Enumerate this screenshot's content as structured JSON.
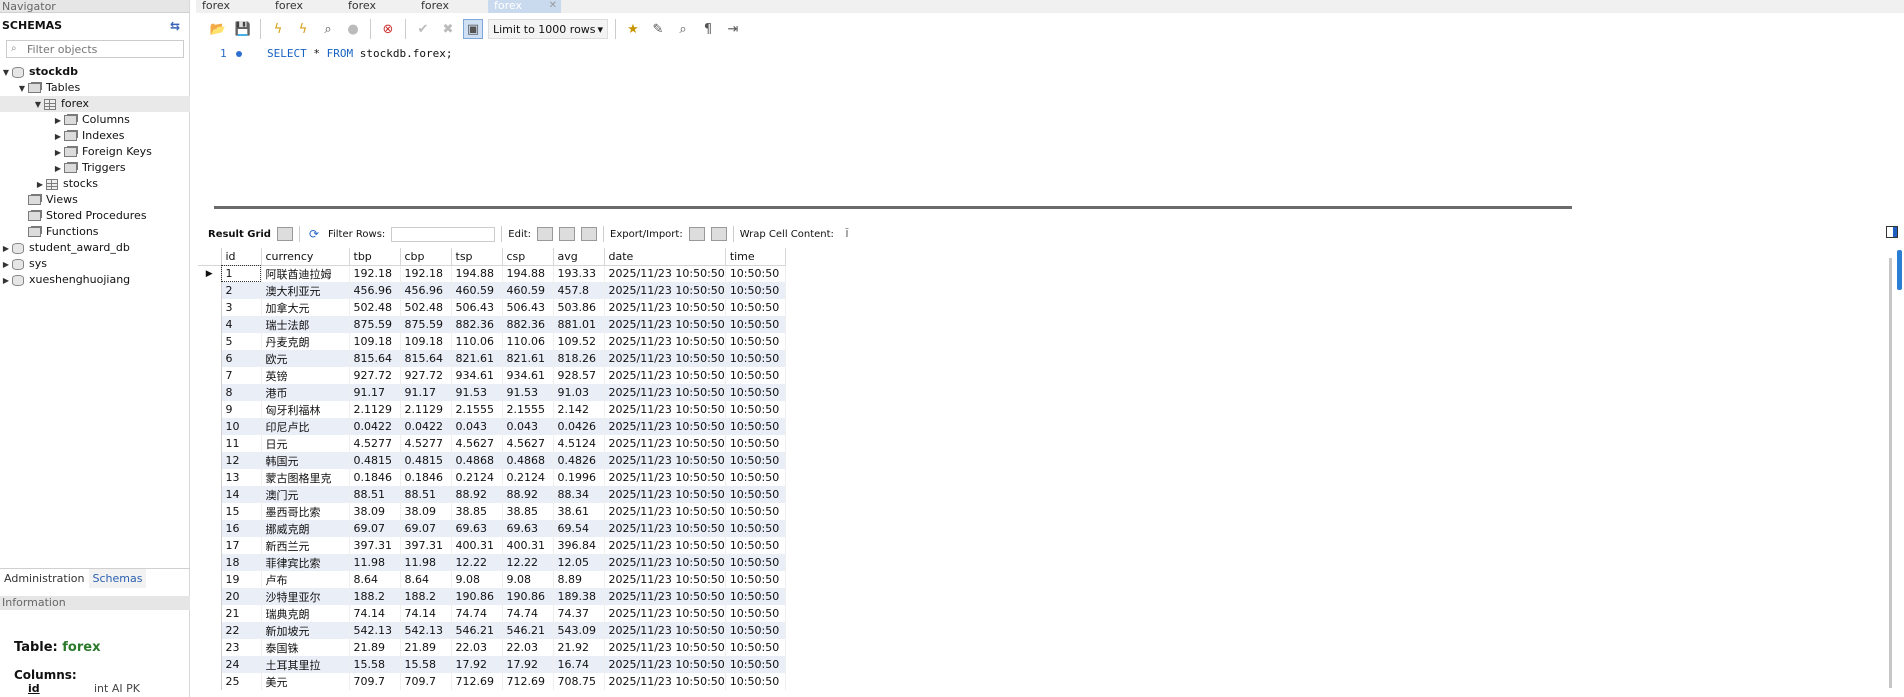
{
  "navigator": {
    "title": "Navigator",
    "schemas_label": "SCHEMAS",
    "filter_placeholder": "Filter objects",
    "tree": [
      {
        "label": "stockdb",
        "bold": true
      },
      {
        "label": "Tables"
      },
      {
        "label": "forex"
      },
      {
        "label": "Columns"
      },
      {
        "label": "Indexes"
      },
      {
        "label": "Foreign Keys"
      },
      {
        "label": "Triggers"
      },
      {
        "label": "stocks"
      },
      {
        "label": "Views"
      },
      {
        "label": "Stored Procedures"
      },
      {
        "label": "Functions"
      },
      {
        "label": "student_award_db"
      },
      {
        "label": "sys"
      },
      {
        "label": "xueshenghuojiang"
      }
    ],
    "bottom_tabs": [
      "Administration",
      "Schemas"
    ],
    "info_title": "Information",
    "info_table_label": "Table:",
    "info_table_name": "forex",
    "info_columns_label": "Columns:",
    "info_col_name": "id",
    "info_col_type": "int AI PK"
  },
  "editor": {
    "tabs": [
      "forex",
      "forex",
      "forex",
      "forex",
      "forex"
    ],
    "limit_label": "Limit to 1000 rows",
    "line_number": "1",
    "sql_kw1": "SELECT",
    "sql_mid": " * ",
    "sql_kw2": "FROM",
    "sql_rest": " stockdb.forex;"
  },
  "result_bar": {
    "result_grid": "Result Grid",
    "filter_rows": "Filter Rows:",
    "edit": "Edit:",
    "export_import": "Export/Import:",
    "wrap": "Wrap Cell Content:"
  },
  "grid": {
    "columns": [
      "id",
      "currency",
      "tbp",
      "cbp",
      "tsp",
      "csp",
      "avg",
      "date",
      "time"
    ],
    "rows": [
      [
        "1",
        "阿联酋迪拉姆",
        "192.18",
        "192.18",
        "194.88",
        "194.88",
        "193.33",
        "2025/11/23 10:50:50",
        "10:50:50"
      ],
      [
        "2",
        "澳大利亚元",
        "456.96",
        "456.96",
        "460.59",
        "460.59",
        "457.8",
        "2025/11/23 10:50:50",
        "10:50:50"
      ],
      [
        "3",
        "加拿大元",
        "502.48",
        "502.48",
        "506.43",
        "506.43",
        "503.86",
        "2025/11/23 10:50:50",
        "10:50:50"
      ],
      [
        "4",
        "瑞士法郎",
        "875.59",
        "875.59",
        "882.36",
        "882.36",
        "881.01",
        "2025/11/23 10:50:50",
        "10:50:50"
      ],
      [
        "5",
        "丹麦克朗",
        "109.18",
        "109.18",
        "110.06",
        "110.06",
        "109.52",
        "2025/11/23 10:50:50",
        "10:50:50"
      ],
      [
        "6",
        "欧元",
        "815.64",
        "815.64",
        "821.61",
        "821.61",
        "818.26",
        "2025/11/23 10:50:50",
        "10:50:50"
      ],
      [
        "7",
        "英镑",
        "927.72",
        "927.72",
        "934.61",
        "934.61",
        "928.57",
        "2025/11/23 10:50:50",
        "10:50:50"
      ],
      [
        "8",
        "港币",
        "91.17",
        "91.17",
        "91.53",
        "91.53",
        "91.03",
        "2025/11/23 10:50:50",
        "10:50:50"
      ],
      [
        "9",
        "匈牙利福林",
        "2.1129",
        "2.1129",
        "2.1555",
        "2.1555",
        "2.142",
        "2025/11/23 10:50:50",
        "10:50:50"
      ],
      [
        "10",
        "印尼卢比",
        "0.0422",
        "0.0422",
        "0.043",
        "0.043",
        "0.0426",
        "2025/11/23 10:50:50",
        "10:50:50"
      ],
      [
        "11",
        "日元",
        "4.5277",
        "4.5277",
        "4.5627",
        "4.5627",
        "4.5124",
        "2025/11/23 10:50:50",
        "10:50:50"
      ],
      [
        "12",
        "韩国元",
        "0.4815",
        "0.4815",
        "0.4868",
        "0.4868",
        "0.4826",
        "2025/11/23 10:50:50",
        "10:50:50"
      ],
      [
        "13",
        "蒙古图格里克",
        "0.1846",
        "0.1846",
        "0.2124",
        "0.2124",
        "0.1996",
        "2025/11/23 10:50:50",
        "10:50:50"
      ],
      [
        "14",
        "澳门元",
        "88.51",
        "88.51",
        "88.92",
        "88.92",
        "88.34",
        "2025/11/23 10:50:50",
        "10:50:50"
      ],
      [
        "15",
        "墨西哥比索",
        "38.09",
        "38.09",
        "38.85",
        "38.85",
        "38.61",
        "2025/11/23 10:50:50",
        "10:50:50"
      ],
      [
        "16",
        "挪威克朗",
        "69.07",
        "69.07",
        "69.63",
        "69.63",
        "69.54",
        "2025/11/23 10:50:50",
        "10:50:50"
      ],
      [
        "17",
        "新西兰元",
        "397.31",
        "397.31",
        "400.31",
        "400.31",
        "396.84",
        "2025/11/23 10:50:50",
        "10:50:50"
      ],
      [
        "18",
        "菲律宾比索",
        "11.98",
        "11.98",
        "12.22",
        "12.22",
        "12.05",
        "2025/11/23 10:50:50",
        "10:50:50"
      ],
      [
        "19",
        "卢布",
        "8.64",
        "8.64",
        "9.08",
        "9.08",
        "8.89",
        "2025/11/23 10:50:50",
        "10:50:50"
      ],
      [
        "20",
        "沙特里亚尔",
        "188.2",
        "188.2",
        "190.86",
        "190.86",
        "189.38",
        "2025/11/23 10:50:50",
        "10:50:50"
      ],
      [
        "21",
        "瑞典克朗",
        "74.14",
        "74.14",
        "74.74",
        "74.74",
        "74.37",
        "2025/11/23 10:50:50",
        "10:50:50"
      ],
      [
        "22",
        "新加坡元",
        "542.13",
        "542.13",
        "546.21",
        "546.21",
        "543.09",
        "2025/11/23 10:50:50",
        "10:50:50"
      ],
      [
        "23",
        "泰国铢",
        "21.89",
        "21.89",
        "22.03",
        "22.03",
        "21.92",
        "2025/11/23 10:50:50",
        "10:50:50"
      ],
      [
        "24",
        "土耳其里拉",
        "15.58",
        "15.58",
        "17.92",
        "17.92",
        "16.74",
        "2025/11/23 10:50:50",
        "10:50:50"
      ],
      [
        "25",
        "美元",
        "709.7",
        "709.7",
        "712.69",
        "712.69",
        "708.75",
        "2025/11/23 10:50:50",
        "10:50:50"
      ]
    ]
  }
}
